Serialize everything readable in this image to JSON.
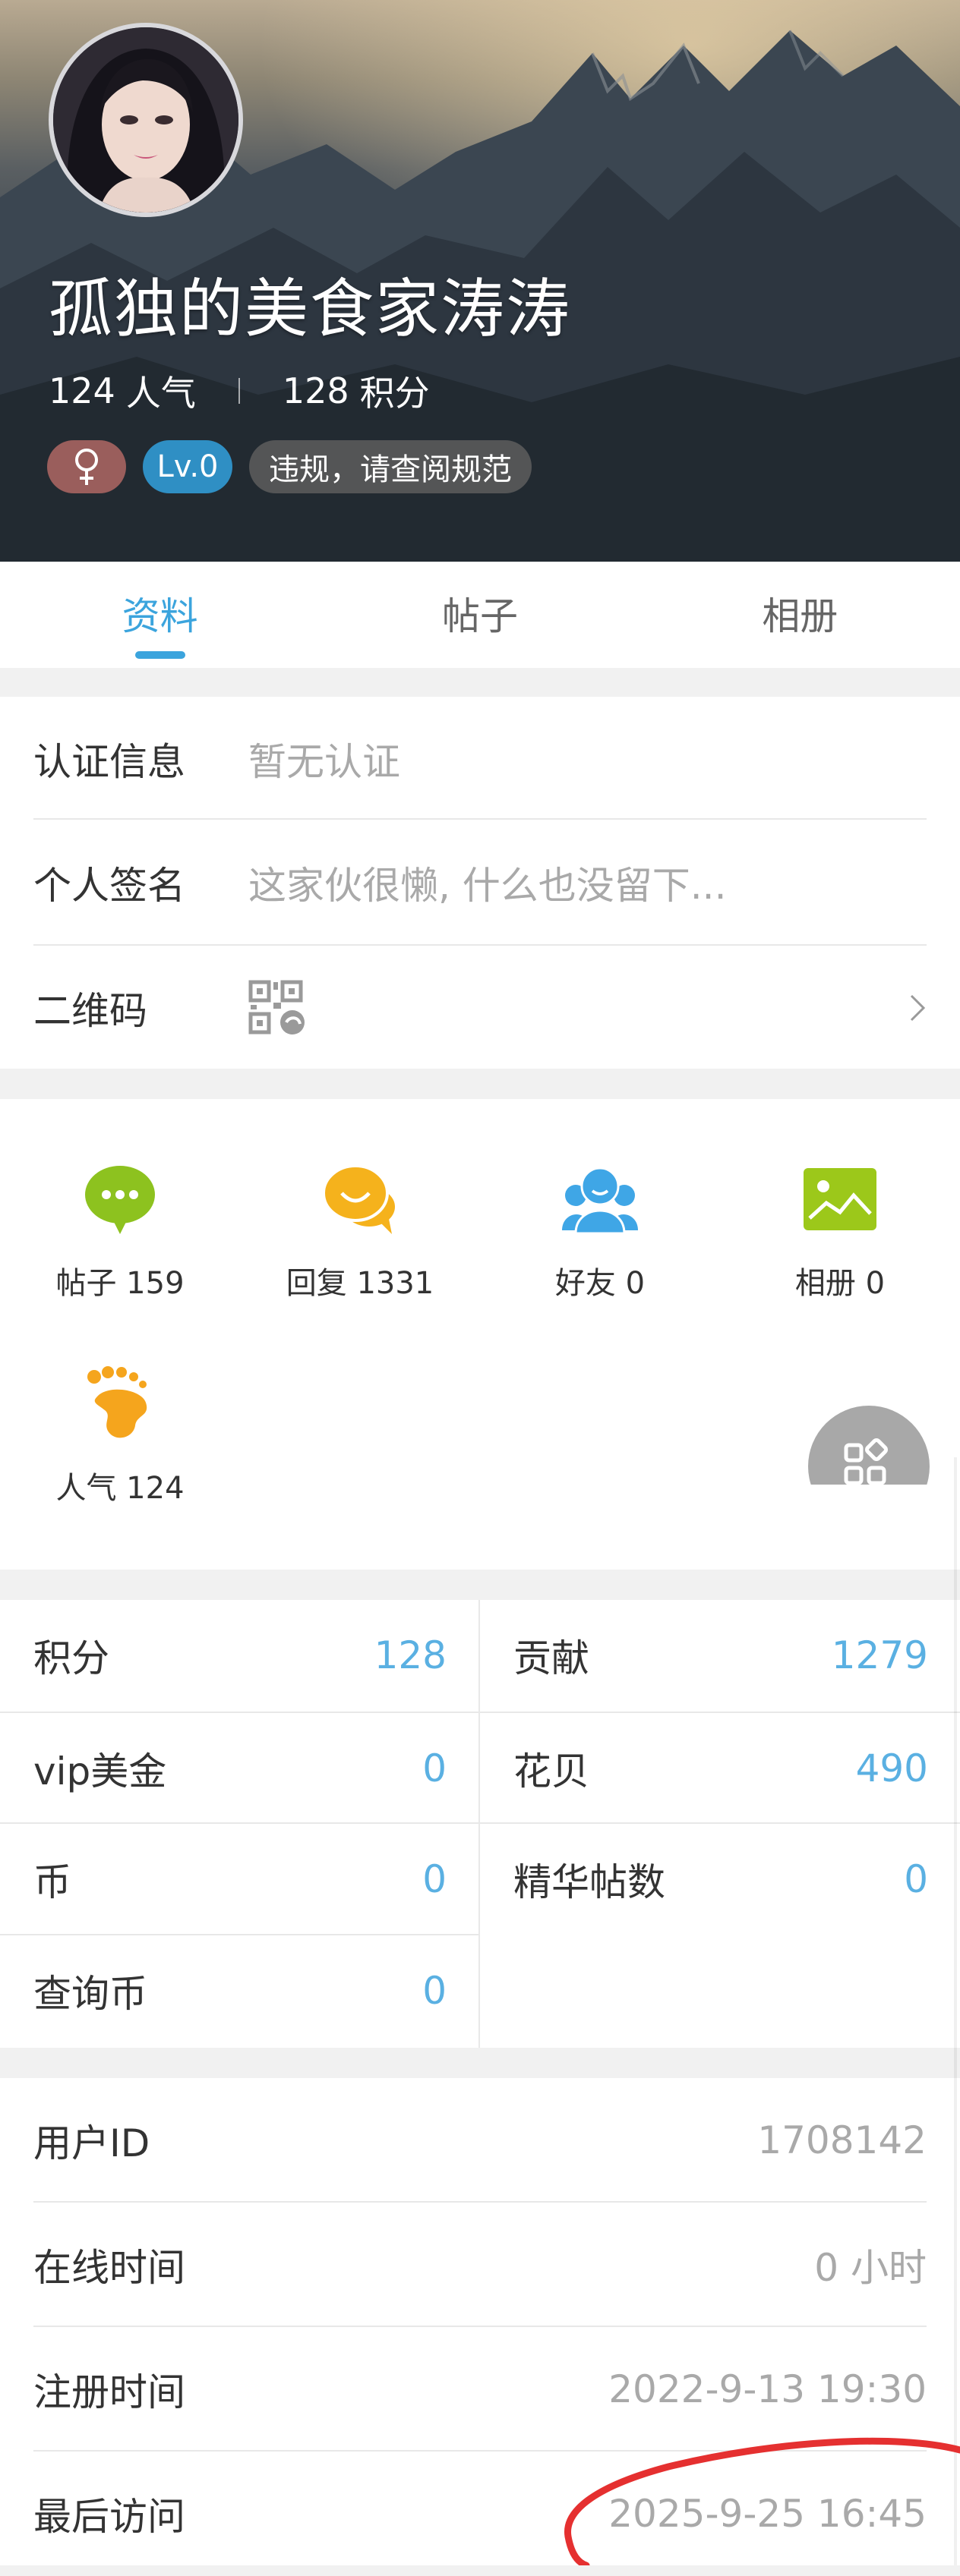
{
  "profile": {
    "username": "孤独的美食家涛涛",
    "popularity_value": "124",
    "popularity_unit": "人气",
    "points_value": "128",
    "points_unit": "积分",
    "gender_symbol": "♀",
    "level": "Lv.0",
    "warning_badge": "违规，请查阅规范"
  },
  "tabs": [
    {
      "label": "资料",
      "active": true
    },
    {
      "label": "帖子",
      "active": false
    },
    {
      "label": "相册",
      "active": false
    }
  ],
  "info": {
    "verification": {
      "label": "认证信息",
      "value": "暂无认证"
    },
    "signature": {
      "label": "个人签名",
      "value": "这家伙很懒, 什么也没留下..."
    },
    "qrcode": {
      "label": "二维码"
    }
  },
  "activity": [
    {
      "label": "帖子 159",
      "icon": "speech-bubble-icon",
      "color": "#8dc21f"
    },
    {
      "label": "回复 1331",
      "icon": "chat-bubbles-icon",
      "color": "#f5b21c"
    },
    {
      "label": "好友 0",
      "icon": "friends-icon",
      "color": "#3fa6e6"
    },
    {
      "label": "相册 0",
      "icon": "photo-icon",
      "color": "#9cc81a"
    },
    {
      "label": "人气 124",
      "icon": "footprint-icon",
      "color": "#f5a51d"
    }
  ],
  "points": {
    "left": [
      {
        "label": "积分",
        "value": "128"
      },
      {
        "label": "vip美金",
        "value": "0"
      },
      {
        "label": "币",
        "value": "0"
      },
      {
        "label": "查询币",
        "value": "0"
      }
    ],
    "right": [
      {
        "label": "贡献",
        "value": "1279"
      },
      {
        "label": "花贝",
        "value": "490"
      },
      {
        "label": "精华帖数",
        "value": "0"
      }
    ]
  },
  "account": [
    {
      "label": "用户ID",
      "value": "1708142"
    },
    {
      "label": "在线时间",
      "value": "0 小时"
    },
    {
      "label": "注册时间",
      "value": "2022-9-13 19:30"
    },
    {
      "label": "最后访问",
      "value": "2025-9-25 16:45"
    }
  ],
  "colors": {
    "accent": "#3ba4dd",
    "value_blue": "#5ab0e2",
    "annotation_red": "#e53030"
  }
}
